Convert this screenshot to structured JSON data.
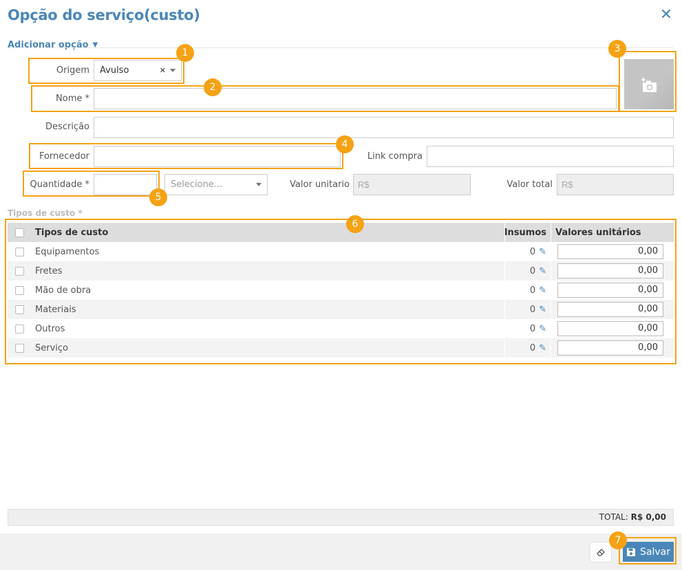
{
  "header": {
    "title": "Opção do serviço(custo)",
    "close_icon": "close-icon"
  },
  "add_option": {
    "label": "Adicionar opção"
  },
  "form": {
    "origem_label": "Origem",
    "origem_value": "Avulso",
    "nome_label": "Nome *",
    "descricao_label": "Descrição",
    "fornecedor_label": "Fornecedor",
    "link_label": "Link compra",
    "quantidade_label": "Quantidade *",
    "unit_placeholder": "Selecione...",
    "valor_unitario_label": "Valor unitario",
    "valor_unitario_value": "R$",
    "valor_total_label": "Valor total",
    "valor_total_value": "R$"
  },
  "section": {
    "label": "Tipos de custo *"
  },
  "table": {
    "headers": {
      "tipo": "Tipos de custo",
      "insumos": "Insumos",
      "valores": "Valores unitários"
    },
    "rows": [
      {
        "name": "Equipamentos",
        "insumos": "0",
        "valor": "0,00"
      },
      {
        "name": "Fretes",
        "insumos": "0",
        "valor": "0,00"
      },
      {
        "name": "Mão de obra",
        "insumos": "0",
        "valor": "0,00"
      },
      {
        "name": "Materiais",
        "insumos": "0",
        "valor": "0,00"
      },
      {
        "name": "Outros",
        "insumos": "0",
        "valor": "0,00"
      },
      {
        "name": "Serviço",
        "insumos": "0",
        "valor": "0,00"
      }
    ]
  },
  "total": {
    "label": "TOTAL:",
    "value": "R$ 0,00"
  },
  "footer": {
    "save_label": "Salvar"
  },
  "badges": [
    "1",
    "2",
    "3",
    "4",
    "5",
    "6",
    "7"
  ],
  "colors": {
    "accent": "#4a86b8",
    "highlight": "#f5a214"
  }
}
